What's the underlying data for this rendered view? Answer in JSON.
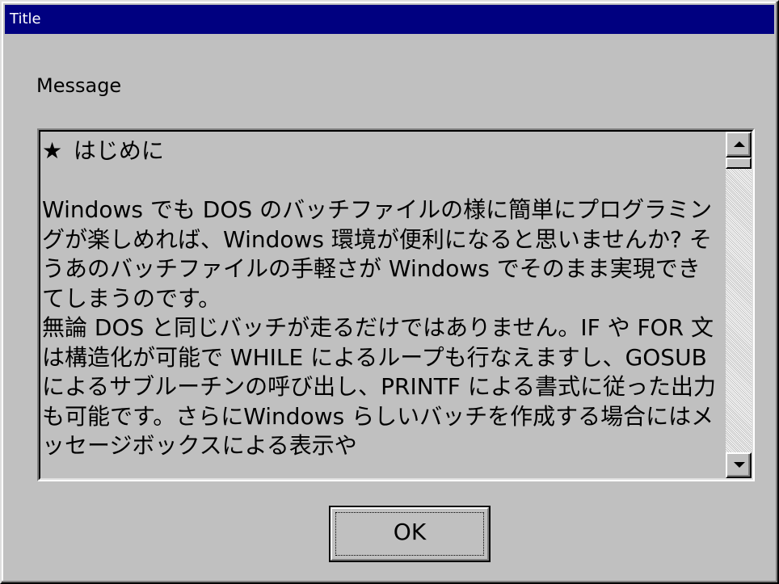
{
  "window": {
    "title": "Title"
  },
  "dialog": {
    "message": "Message",
    "heading_star": "★",
    "heading_text": " はじめに",
    "body_text": "Windows でも DOS のバッチファイルの様に簡単にプログラミングが楽しめれば、Windows 環境が便利になると思いませんか? そうあのバッチファイルの手軽さが Windows でそのまま実現できてしまうのです。\n無論 DOS と同じバッチが走るだけではありません。IF や FOR 文は構造化が可能で WHILE によるループも行なえますし、GOSUB によるサブルーチンの呼び出し、PRINTF による書式に従った出力も可能です。さらにWindows らしいバッチを作成する場合にはメッセージボックスによる表示や",
    "ok_label": "OK"
  },
  "icons": {
    "scroll_up": "arrow-up-icon",
    "scroll_down": "arrow-down-icon"
  },
  "colors": {
    "titlebar": "#000080",
    "face": "#c0c0c0"
  }
}
